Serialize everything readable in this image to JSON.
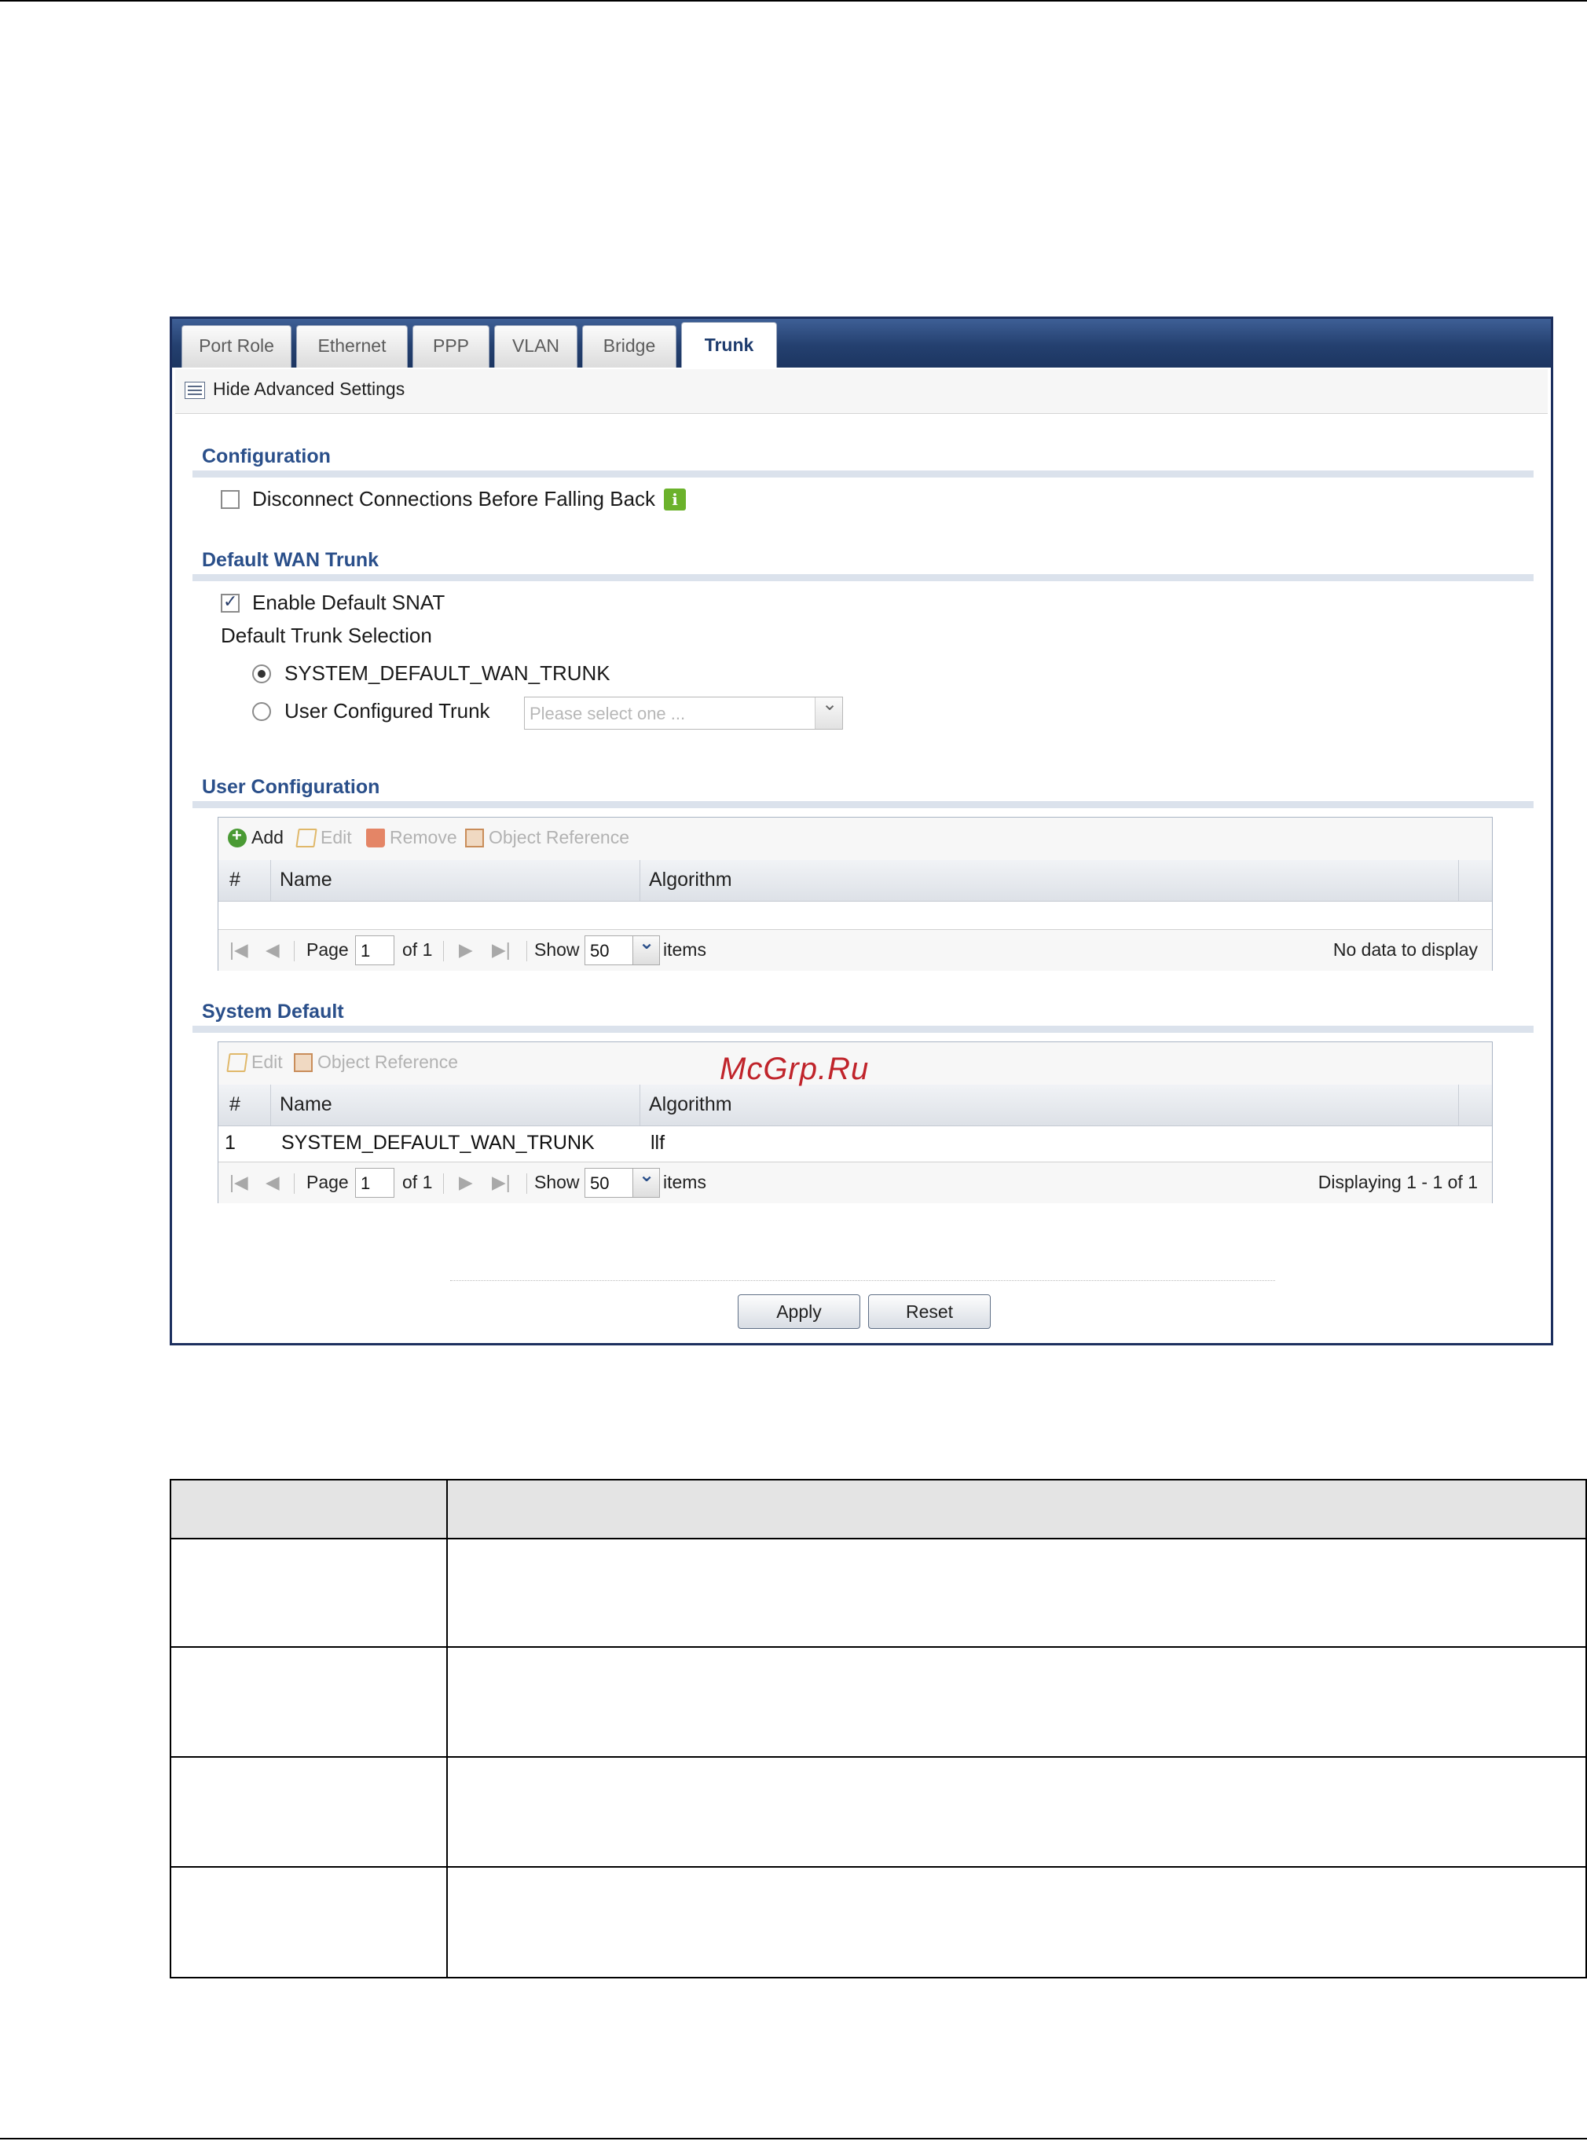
{
  "tabs": [
    "Port Role",
    "Ethernet",
    "PPP",
    "VLAN",
    "Bridge",
    "Trunk"
  ],
  "active_tab": "Trunk",
  "subbar": {
    "toggle_label": "Hide Advanced Settings"
  },
  "configuration": {
    "title": "Configuration",
    "disconnect_label": "Disconnect Connections Before Falling Back",
    "disconnect_checked": false
  },
  "default_wan_trunk": {
    "title": "Default WAN Trunk",
    "enable_snat_label": "Enable Default SNAT",
    "enable_snat_checked": true,
    "selection_label": "Default Trunk Selection",
    "option_system": "SYSTEM_DEFAULT_WAN_TRUNK",
    "option_user": "User Configured Trunk",
    "selected_option": "system",
    "select_placeholder": "Please select one ..."
  },
  "user_configuration": {
    "title": "User Configuration",
    "toolbar": {
      "add": "Add",
      "edit": "Edit",
      "remove": "Remove",
      "object_reference": "Object Reference"
    },
    "columns": {
      "num": "#",
      "name": "Name",
      "algorithm": "Algorithm"
    },
    "rows": [],
    "pager": {
      "page_label": "Page",
      "page_value": "1",
      "of_label": "of 1",
      "show_label": "Show",
      "show_value": "50",
      "items_label": "items",
      "status": "No data to display"
    }
  },
  "system_default": {
    "title": "System Default",
    "toolbar": {
      "edit": "Edit",
      "object_reference": "Object Reference"
    },
    "columns": {
      "num": "#",
      "name": "Name",
      "algorithm": "Algorithm"
    },
    "rows": [
      {
        "num": "1",
        "name": "SYSTEM_DEFAULT_WAN_TRUNK",
        "algorithm": "llf"
      }
    ],
    "pager": {
      "page_label": "Page",
      "page_value": "1",
      "of_label": "of 1",
      "show_label": "Show",
      "show_value": "50",
      "items_label": "items",
      "status": "Displaying 1 - 1 of 1"
    }
  },
  "buttons": {
    "apply": "Apply",
    "reset": "Reset"
  },
  "watermark": "McGrp.Ru",
  "colors": {
    "tabbar": "#24406f",
    "section_title": "#2a4f8a",
    "info_icon": "#6bb22b",
    "watermark": "#c0242b"
  }
}
